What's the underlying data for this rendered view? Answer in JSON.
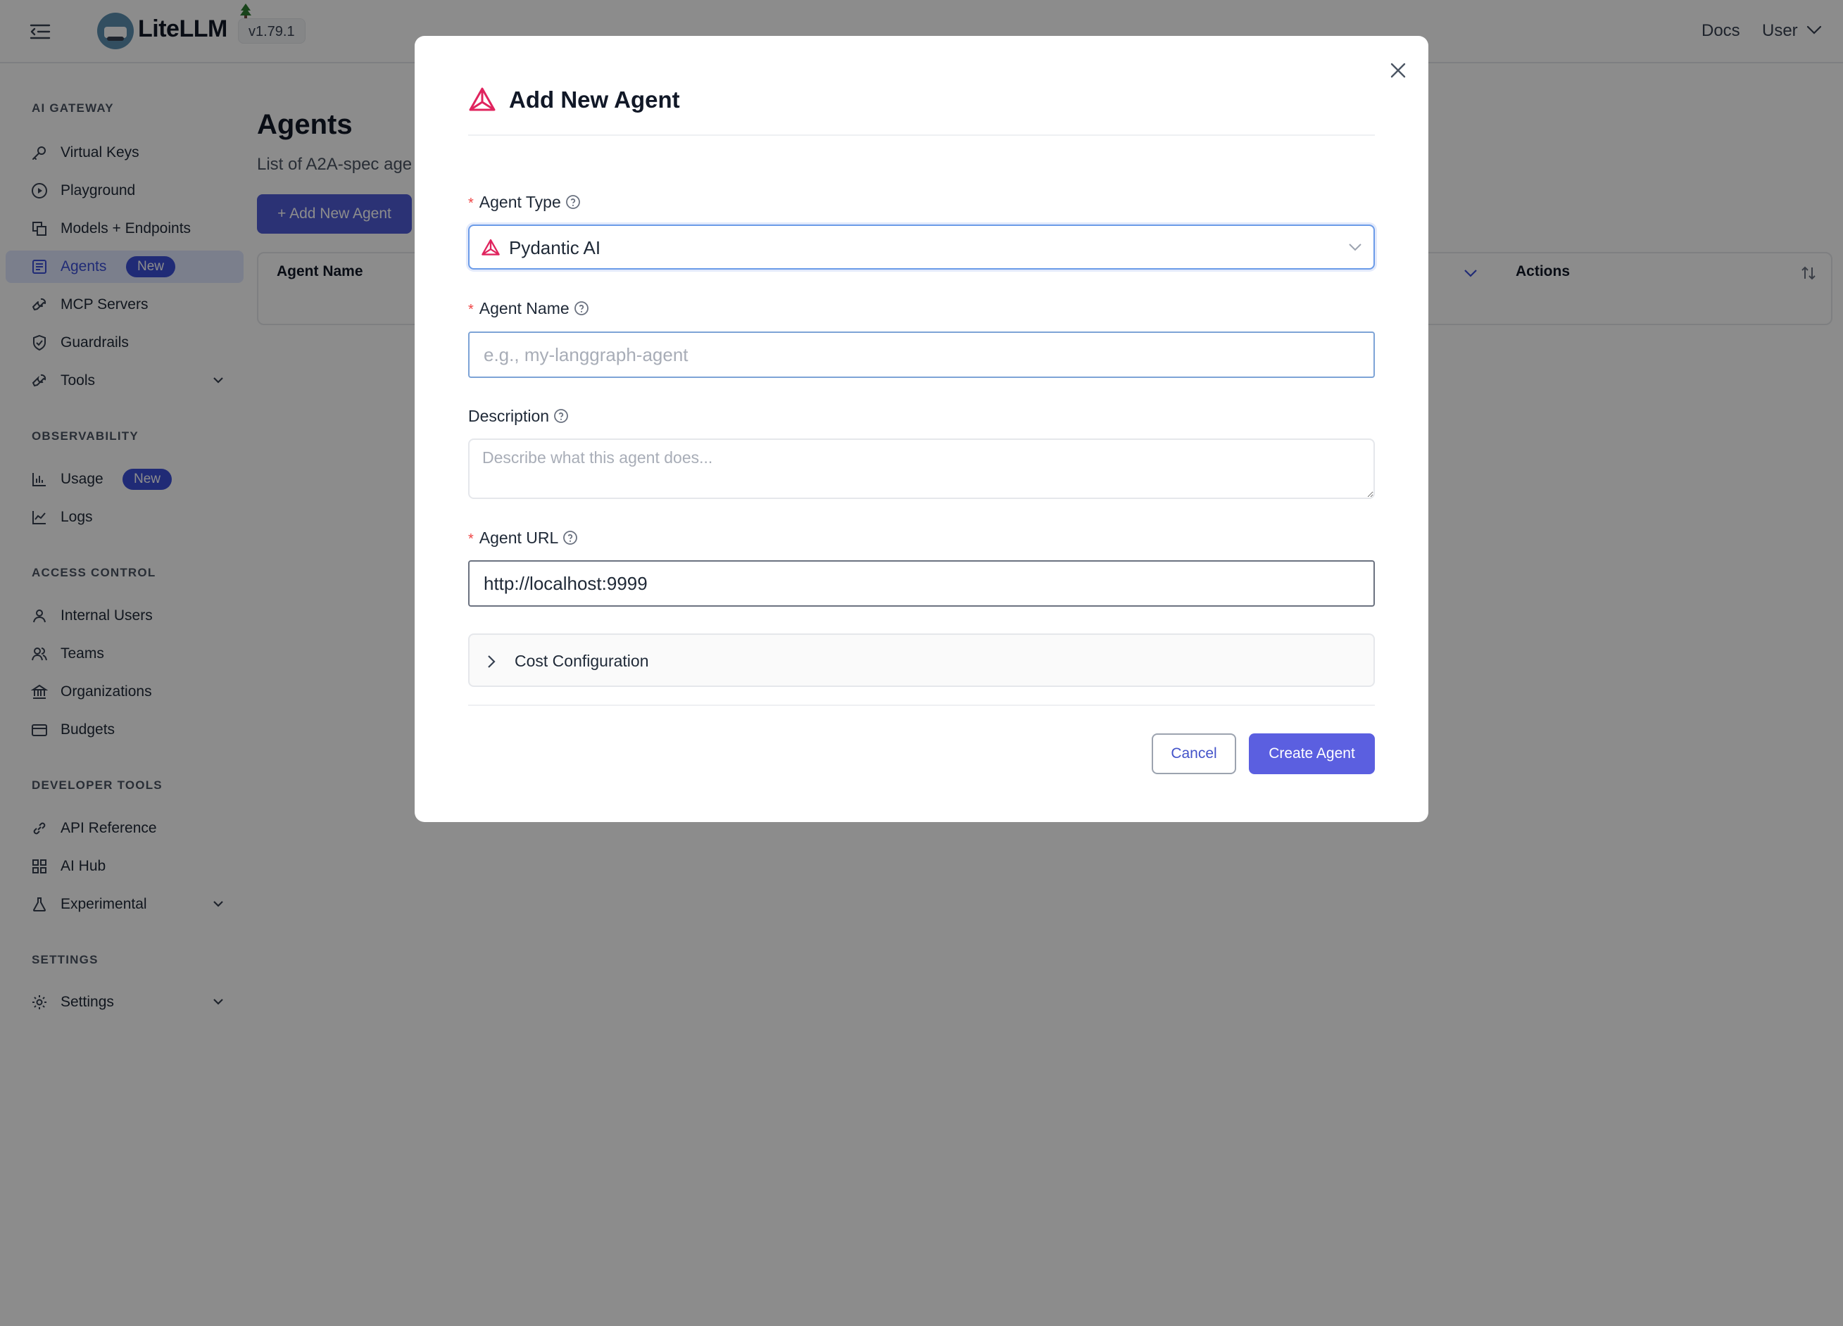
{
  "header": {
    "brand": "LiteLLM",
    "version": "v1.79.1",
    "docs": "Docs",
    "user": "User"
  },
  "sidebar": {
    "sections": [
      "AI GATEWAY",
      "OBSERVABILITY",
      "ACCESS CONTROL",
      "DEVELOPER TOOLS",
      "SETTINGS"
    ],
    "items": [
      {
        "label": "Virtual Keys",
        "icon": "key-icon"
      },
      {
        "label": "Playground",
        "icon": "play-circle-icon"
      },
      {
        "label": "Models + Endpoints",
        "icon": "layers-icon"
      },
      {
        "label": "Agents",
        "icon": "agent-icon",
        "badge": "New",
        "active": true
      },
      {
        "label": "MCP Servers",
        "icon": "wrench-icon"
      },
      {
        "label": "Guardrails",
        "icon": "shield-icon"
      },
      {
        "label": "Tools",
        "icon": "tool-icon",
        "expandable": true
      },
      {
        "label": "Usage",
        "icon": "bar-chart-icon",
        "badge": "New"
      },
      {
        "label": "Logs",
        "icon": "line-chart-icon"
      },
      {
        "label": "Internal Users",
        "icon": "user-icon"
      },
      {
        "label": "Teams",
        "icon": "team-icon"
      },
      {
        "label": "Organizations",
        "icon": "bank-icon"
      },
      {
        "label": "Budgets",
        "icon": "wallet-icon"
      },
      {
        "label": "API Reference",
        "icon": "api-icon"
      },
      {
        "label": "AI Hub",
        "icon": "grid-icon"
      },
      {
        "label": "Experimental",
        "icon": "flask-icon",
        "expandable": true
      },
      {
        "label": "Settings",
        "icon": "gear-icon",
        "expandable": true
      }
    ]
  },
  "main": {
    "title": "Agents",
    "subtitle": "List of A2A-spec age",
    "add_button": "+ Add New Agent",
    "table_headers": [
      "Agent Name",
      "Actions"
    ]
  },
  "modal": {
    "title": "Add New Agent",
    "agent_type_label": "Agent Type",
    "agent_type_value": "Pydantic AI",
    "agent_name_label": "Agent Name",
    "agent_name_placeholder": "e.g., my-langgraph-agent",
    "description_label": "Description",
    "description_placeholder": "Describe what this agent does...",
    "agent_url_label": "Agent URL",
    "agent_url_value": "http://localhost:9999",
    "cost_configuration": "Cost Configuration",
    "cancel": "Cancel",
    "create": "Create Agent",
    "required_mark": "*"
  },
  "colors": {
    "accent": "#4f5bd5",
    "active_bg": "#e0e7ff",
    "required": "#ef4444",
    "pydantic": "#e0245e"
  }
}
